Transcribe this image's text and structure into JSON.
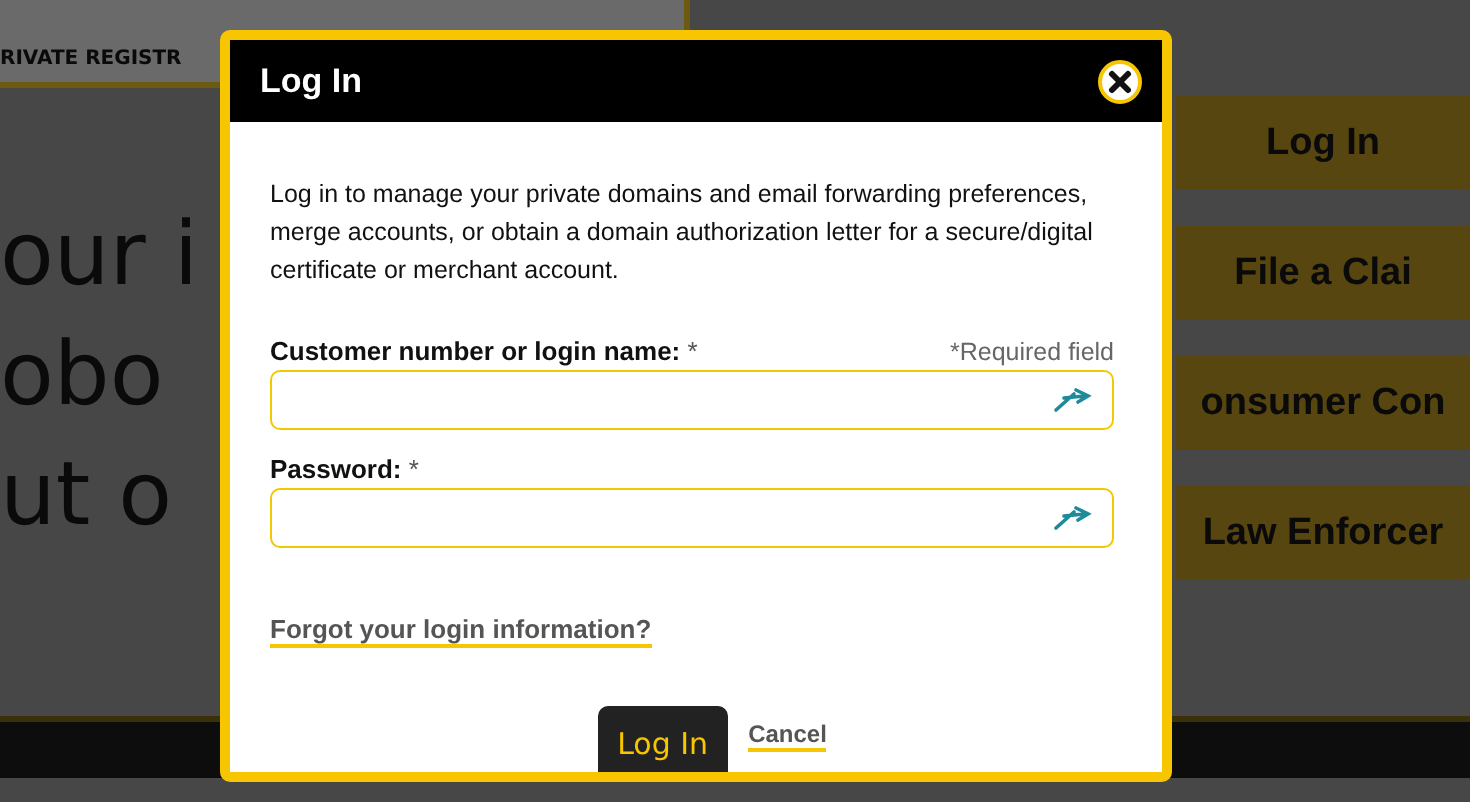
{
  "background": {
    "logo_tagline": "RIVATE REGISTR",
    "headline_lines": [
      "our i",
      "obo",
      "ut o"
    ],
    "menu": [
      {
        "label": "Log In"
      },
      {
        "label": "File a Clai"
      },
      {
        "label": "onsumer Con"
      },
      {
        "label": "Law Enforcer"
      }
    ]
  },
  "dialog": {
    "title": "Log In",
    "intro": "Log in to manage your private domains and email forwarding preferences, merge accounts, or obtain a domain authorization letter for a secure/digital certificate or merchant account.",
    "required_note": "*Required field",
    "fields": [
      {
        "label": "Customer number or login name:",
        "required_mark": "*"
      },
      {
        "label": "Password:",
        "required_mark": "*"
      }
    ],
    "forgot_link": "Forgot your login information?",
    "submit": "Log In",
    "cancel": "Cancel"
  }
}
